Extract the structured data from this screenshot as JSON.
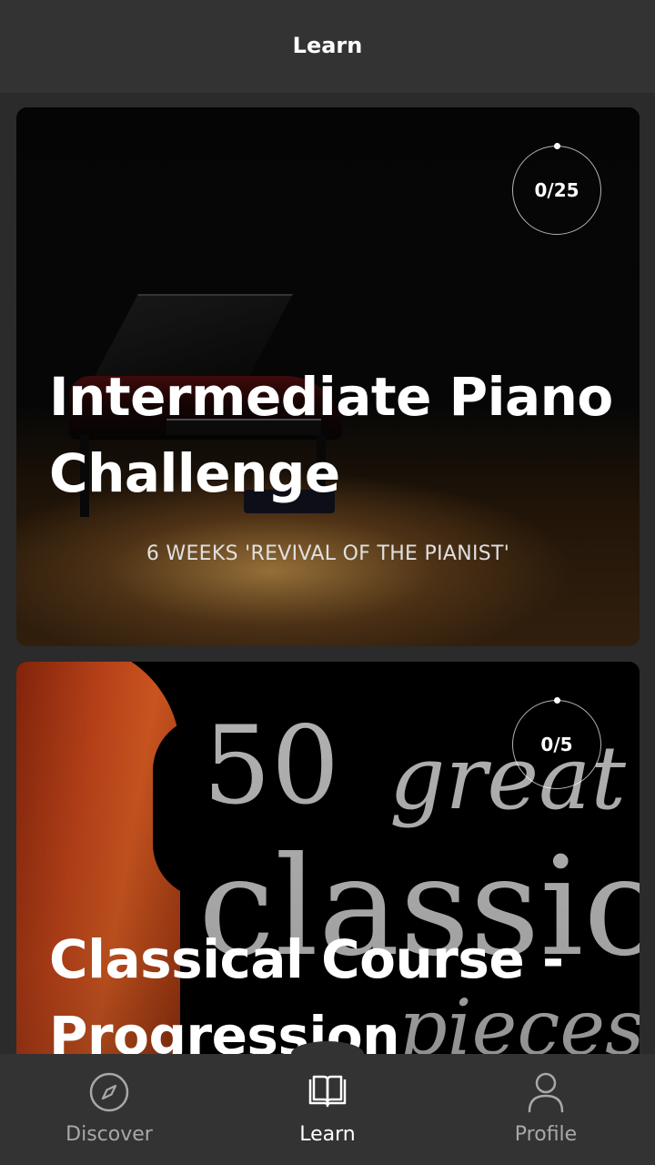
{
  "header": {
    "title": "Learn"
  },
  "courses": [
    {
      "title": "Intermediate Piano Challenge",
      "subtitle": "6 WEEKS 'REVIVAL OF THE PIANIST'",
      "progress": "0/25",
      "progress_fraction": 0
    },
    {
      "title": "Classical Course - Progression",
      "image_text": {
        "line1": "50",
        "line2": "great",
        "line3": "classic",
        "line4": "pieces"
      },
      "progress": "0/5",
      "progress_fraction": 0
    }
  ],
  "bottom_nav": {
    "items": [
      {
        "label": "Discover",
        "icon": "compass-icon",
        "active": false
      },
      {
        "label": "Learn",
        "icon": "book-icon",
        "active": true
      },
      {
        "label": "Profile",
        "icon": "person-icon",
        "active": false
      }
    ]
  },
  "colors": {
    "header_bg": "#333333",
    "page_bg": "#2b2b2b",
    "nav_inactive": "#a8a8a8",
    "nav_active": "#ffffff"
  }
}
